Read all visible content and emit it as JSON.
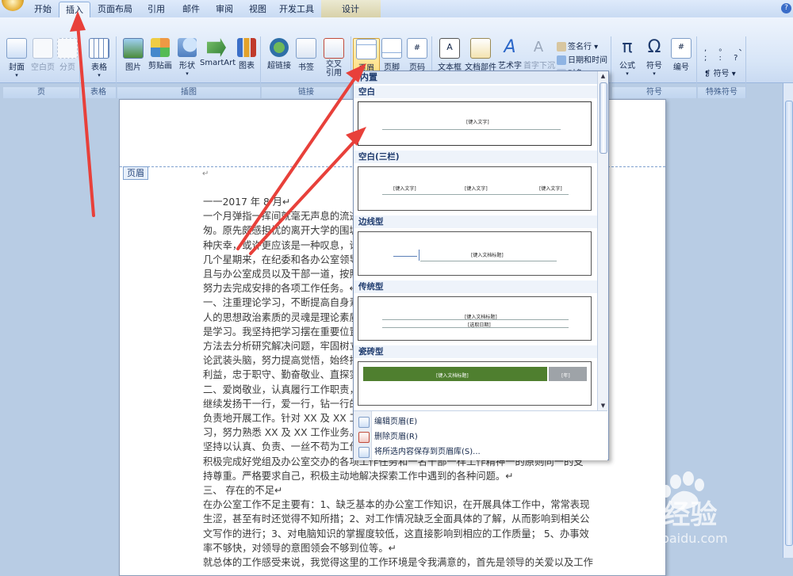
{
  "tabs": [
    {
      "label": "开始",
      "active": false
    },
    {
      "label": "插入",
      "active": true
    },
    {
      "label": "页面布局",
      "active": false
    },
    {
      "label": "引用",
      "active": false
    },
    {
      "label": "邮件",
      "active": false
    },
    {
      "label": "审阅",
      "active": false
    },
    {
      "label": "视图",
      "active": false
    },
    {
      "label": "开发工具",
      "active": false
    },
    {
      "label": "设计",
      "active": false
    }
  ],
  "ribbon": {
    "page_group": {
      "label": "页",
      "cover": "封面",
      "blank": "空白页",
      "break": "分页"
    },
    "table_group": {
      "label": "表格",
      "table": "表格"
    },
    "illustration_group": {
      "label": "插图",
      "picture": "图片",
      "clipart": "剪贴画",
      "shape": "形状",
      "smartart": "SmartArt",
      "chart": "图表"
    },
    "link_group": {
      "label": "链接",
      "hyperlink": "超链接",
      "bookmark": "书签",
      "crossref": "交叉\n引用"
    },
    "hf_group": {
      "header": "页眉",
      "footer": "页脚",
      "pagenum": "页码"
    },
    "text_group": {
      "textbox": "文本框",
      "parts": "文档部件",
      "wordart": "艺术字",
      "dropcap": "首字下沉",
      "signature": "签名行",
      "datetime": "日期和时间",
      "object": "对象"
    },
    "symbol_group": {
      "label": "符号",
      "equation": "公式",
      "symbol": "符号",
      "number": "编号"
    },
    "special_group": {
      "label": "特殊符号",
      "symbol": "符号"
    }
  },
  "header_tag": "页眉",
  "dropdown": {
    "section": "内置",
    "categories": [
      "空白",
      "空白(三栏)",
      "边线型",
      "传统型",
      "瓷砖型"
    ],
    "placeholders": {
      "blank": "[键入文字]",
      "three_col": [
        "[键入文字]",
        "[键入文字]",
        "[键入文字]"
      ],
      "edge": "[键入文档标题]",
      "classic": [
        "[键入文档标题]",
        "[选取日期]"
      ],
      "tile": [
        "[键入文档标题]",
        "[年]"
      ]
    },
    "actions": [
      "编辑页眉(E)",
      "删除页眉(R)",
      "将所选内容保存到页眉库(S)..."
    ]
  },
  "document": {
    "lines": [
      "一一2017 年 8 月↵",
      "一个月弹指一挥间就毫无声息的流逝",
      "匆。原先颇感担忧的离开大学的围城",
      "种庆幸，或许更应该是一种叹息，谁",
      "几个星期来，在纪委和各办公室领导",
      "且与办公室成员以及干部一道，按照",
      "努力去完成安排的各项工作任务。↵",
      "一、注重理论学习，不断提高自身素",
      "人的思想政治素质的灵魂是理论素质",
      "是学习。我坚持把学习摆在重要位置",
      "方法去分析研究解决问题，牢固树立",
      "论武装头脑，努力提高觉悟，始终把",
      "利益，忠于职守、勤奋敬业、直探实",
      "二、爱岗敬业，认真履行工作职责，",
      "继续发扬干一行，爱一行，钻一行的",
      "负责地开展工作。针对 XX 及 XX 工作",
      "习，努力熟悉 XX 及 XX 工作业务。不",
      "坚持以认真、负责、一丝不苟为工作",
      "积极完成好党组及办公室交办的各项工作任务和一名干部一样工作精神一的原则同一的支",
      "持尊重。严格要求自己，积极主动地解决探索工作中遇到的各种问题。↵",
      "三、  存在的不足↵",
      "在办公室工作不足主要有：1、缺乏基本的办公室工作知识，在开展具体工作中，常常表现",
      "生涩，甚至有时还觉得不知所措；2、对工作情况缺乏全面具体的了解，从而影响到相关公",
      "文写作的进行；3、对电脑知识的掌握度较低，这直接影响到相应的工作质量；  5、办事效",
      "率不够快，对领导的意图领会不够到位等。↵",
      "就总体的工作感受来说，我觉得这里的工作环境是令我满意的，首先是领导的关爱以及工作"
    ]
  },
  "watermark": {
    "brand": "Bai 经验",
    "url": "jingyan.baidu.com"
  },
  "colors": {
    "accent": "#e8403a",
    "tile_green": "#4f7f2f"
  }
}
